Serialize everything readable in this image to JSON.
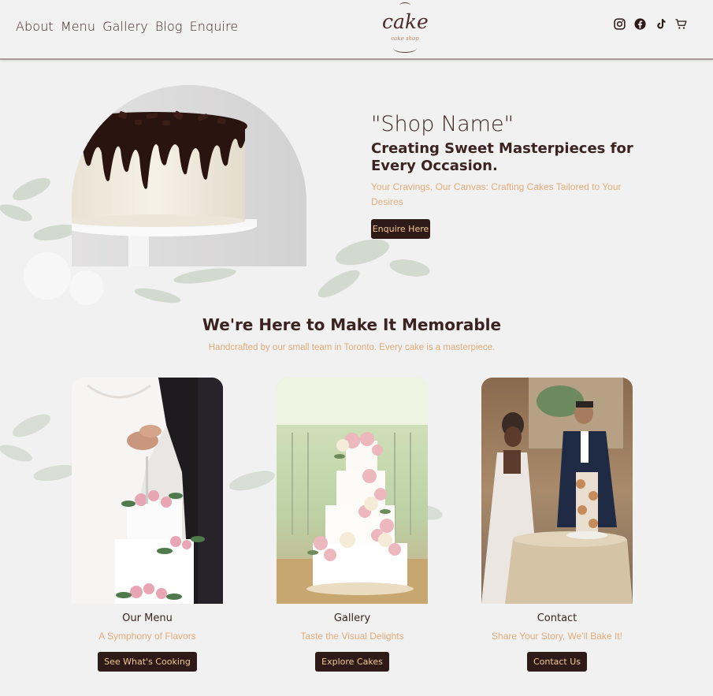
{
  "nav": {
    "items": [
      "About",
      "Menu",
      "Gallery",
      "Blog",
      "Enquire"
    ]
  },
  "logo": {
    "word": "cake",
    "sub": "cake shop"
  },
  "social": [
    "instagram-icon",
    "facebook-icon",
    "tiktok-icon",
    "cart-icon"
  ],
  "hero": {
    "shop_name": "\"Shop Name\"",
    "heading": "Creating Sweet Masterpieces for Every Occasion.",
    "subheading": "Your Cravings, Our Canvas: Crafting Cakes Tailored to Your Desires",
    "button": "Enquire Here"
  },
  "memorable": {
    "title": "We're Here to Make It Memorable",
    "subtitle": "Handcrafted by our small team in Toronto. Every cake is a masterpiece."
  },
  "cards": [
    {
      "title": "Our Menu",
      "subtitle": "A Symphony of Flavors",
      "button": "See What's Cooking"
    },
    {
      "title": "Gallery",
      "subtitle": "Taste the Visual Delights",
      "button": "Explore Cakes"
    },
    {
      "title": "Contact",
      "subtitle": "Share Your Story, We'll Bake It!",
      "button": "Contact Us"
    }
  ],
  "colors": {
    "background": "#f2f1f1",
    "text": "#3b2322",
    "accent": "#e0ac7a",
    "button_bg": "#2e1a17",
    "button_text": "#f3c893"
  }
}
